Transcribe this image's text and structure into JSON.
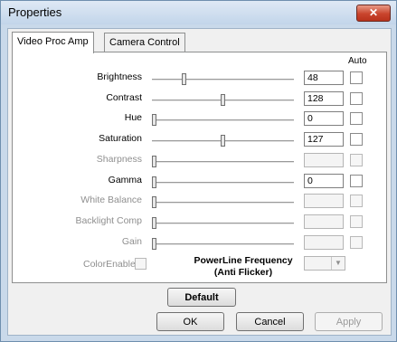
{
  "window": {
    "title": "Properties",
    "close_glyph": "✕"
  },
  "tabs": [
    {
      "label": "Video Proc Amp",
      "active": true
    },
    {
      "label": "Camera Control",
      "active": false
    }
  ],
  "auto_header": "Auto",
  "properties": [
    {
      "label": "Brightness",
      "value": "48",
      "level": 0.22,
      "enabled": true
    },
    {
      "label": "Contrast",
      "value": "128",
      "level": 0.5,
      "enabled": true
    },
    {
      "label": "Hue",
      "value": "0",
      "level": 0.0,
      "enabled": true
    },
    {
      "label": "Saturation",
      "value": "127",
      "level": 0.5,
      "enabled": true
    },
    {
      "label": "Sharpness",
      "value": "",
      "level": 0.0,
      "enabled": false
    },
    {
      "label": "Gamma",
      "value": "0",
      "level": 0.0,
      "enabled": true
    },
    {
      "label": "White Balance",
      "value": "",
      "level": 0.0,
      "enabled": false
    },
    {
      "label": "Backlight Comp",
      "value": "",
      "level": 0.0,
      "enabled": false
    },
    {
      "label": "Gain",
      "value": "",
      "level": 0.0,
      "enabled": false
    }
  ],
  "color_enable_label": "ColorEnable",
  "powerline": {
    "line1": "PowerLine Frequency",
    "line2": "(Anti Flicker)"
  },
  "buttons": {
    "default": "Default",
    "ok": "OK",
    "cancel": "Cancel",
    "apply": "Apply"
  }
}
